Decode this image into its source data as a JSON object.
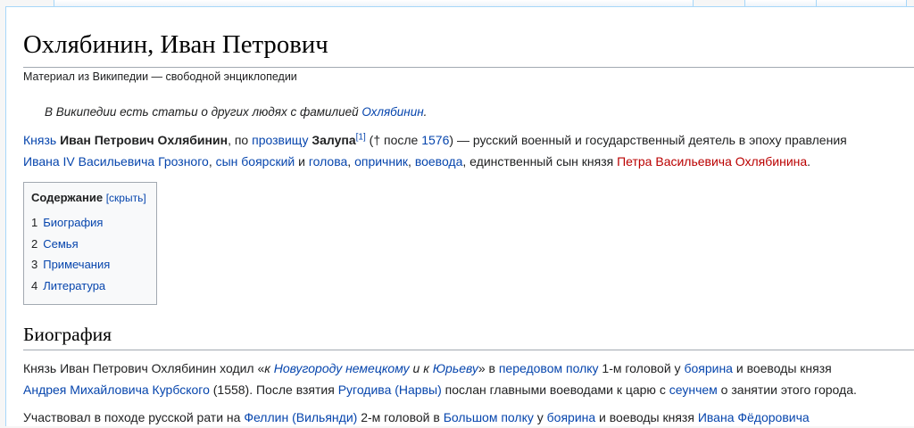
{
  "page": {
    "title": "Охлябинин, Иван Петрович",
    "tagline": "Материал из Википедии — свободной энциклопедии"
  },
  "hatnote": {
    "text": "В Википедии есть статьи о других людях с фамилией ",
    "link": "Охлябинин",
    "end": "."
  },
  "lead": {
    "knyaz_link": "Князь",
    "name_bold": "Иван Петрович Охлябинин",
    "t1": ", по ",
    "nickname_link": "прозвищу",
    "nickname_bold": "Залупа",
    "ref": "[1]",
    "t2": " († после ",
    "year_link": "1576",
    "t3": ") — русский военный и государственный деятель в эпоху правления",
    "tsar_link": "Ивана IV Васильевича Грозного",
    "comma1": ", ",
    "boyar_son_link": "сын боярский",
    "and1": " и ",
    "golova_link": "голова",
    "comma2": ", ",
    "oprichnik_link": "опричник",
    "comma3": ", ",
    "voevoda_link": "воевода",
    "t4": ", единственный сын князя ",
    "father_link": "Петра Васильевича Охлябинина",
    "end": "."
  },
  "toc": {
    "title": "Содержание",
    "toggle": "[скрыть]",
    "items": [
      {
        "num": "1",
        "label": "Биография"
      },
      {
        "num": "2",
        "label": "Семья"
      },
      {
        "num": "3",
        "label": "Примечания"
      },
      {
        "num": "4",
        "label": "Литература"
      }
    ]
  },
  "section": {
    "heading": "Биография"
  },
  "bio1": {
    "t1": "Князь Иван Петрович Охлябинин ходил «",
    "i1": "к ",
    "novgorod_link": "Новугороду немецкому",
    "i2": " и к ",
    "yuryev_link": "Юрьеву",
    "t2": "» в ",
    "regiment_link": "передовом полку",
    "t3": " 1-м головой у ",
    "boyar_link": "боярина",
    "t4": " и воеводы князя",
    "kurbsky_link": "Андрея Михайловича Курбского",
    "t5": " (1558). После взятия ",
    "rugodiv_link": "Ругодива (Нарвы)",
    "t6": " послан главными воеводами к царю с ",
    "seunch_link": "сеунчем",
    "t7": " о занятии этого города."
  },
  "bio2": {
    "t1": "Участвовал в походе русской рати на ",
    "fellin_link": "Феллин (Вильянди)",
    "t2": " 2-м головой в ",
    "bigregiment_link": "Большом полку",
    "t3": " у ",
    "boyar_link": "боярина",
    "t4": " и воеводы князя ",
    "ivan_link": "Ивана Фёдоровича"
  },
  "colors": {
    "link": "#0645ad",
    "redlink": "#ba0000",
    "border": "#a7d7f9",
    "rule": "#a2a9b1"
  }
}
